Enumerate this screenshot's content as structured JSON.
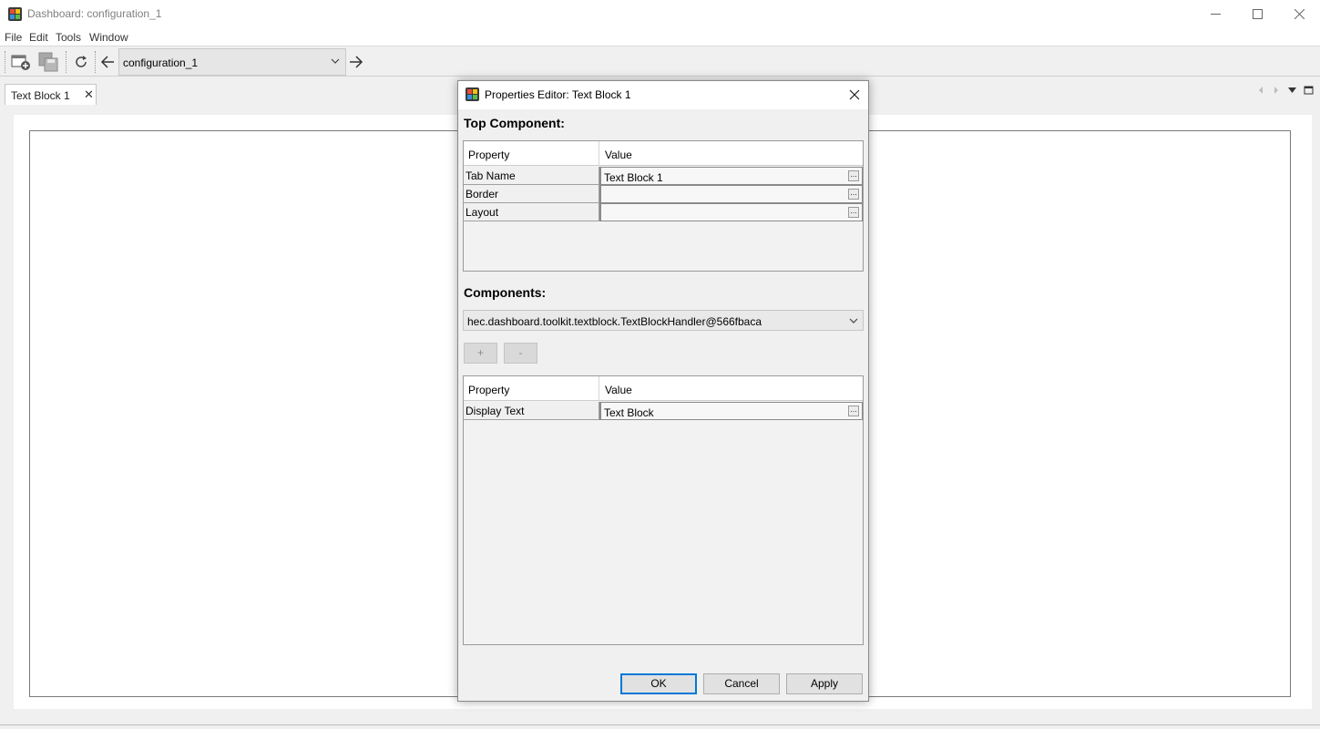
{
  "window": {
    "title": "Dashboard: configuration_1",
    "controls": {
      "minimize_icon": "minimize-icon",
      "maximize_icon": "maximize-icon",
      "close_icon": "close-icon"
    }
  },
  "menubar": {
    "items": [
      "File",
      "Edit",
      "Tools",
      "Window"
    ]
  },
  "toolbar": {
    "config_select": "configuration_1",
    "icons": [
      "new-tab-icon",
      "save-icon",
      "refresh-icon",
      "back-arrow-icon",
      "forward-arrow-icon"
    ]
  },
  "tabs": [
    {
      "label": "Text Block 1",
      "close": "✕"
    }
  ],
  "dialog": {
    "title": "Properties Editor: Text Block 1",
    "top_component": {
      "label": "Top Component:",
      "header": {
        "property": "Property",
        "value": "Value"
      },
      "rows": [
        {
          "property": "Tab Name",
          "value": "Text Block 1"
        },
        {
          "property": "Border",
          "value": ""
        },
        {
          "property": "Layout",
          "value": ""
        }
      ]
    },
    "components": {
      "label": "Components:",
      "selected": "hec.dashboard.toolkit.textblock.TextBlockHandler@566fbaca",
      "add_label": "+",
      "remove_label": "-",
      "header": {
        "property": "Property",
        "value": "Value"
      },
      "rows": [
        {
          "property": "Display Text",
          "value": "Text Block"
        }
      ]
    },
    "buttons": {
      "ok": "OK",
      "cancel": "Cancel",
      "apply": "Apply"
    },
    "ellipsis": "..."
  },
  "colors": {
    "accent": "#0078d7",
    "background": "#f0f0f0"
  }
}
